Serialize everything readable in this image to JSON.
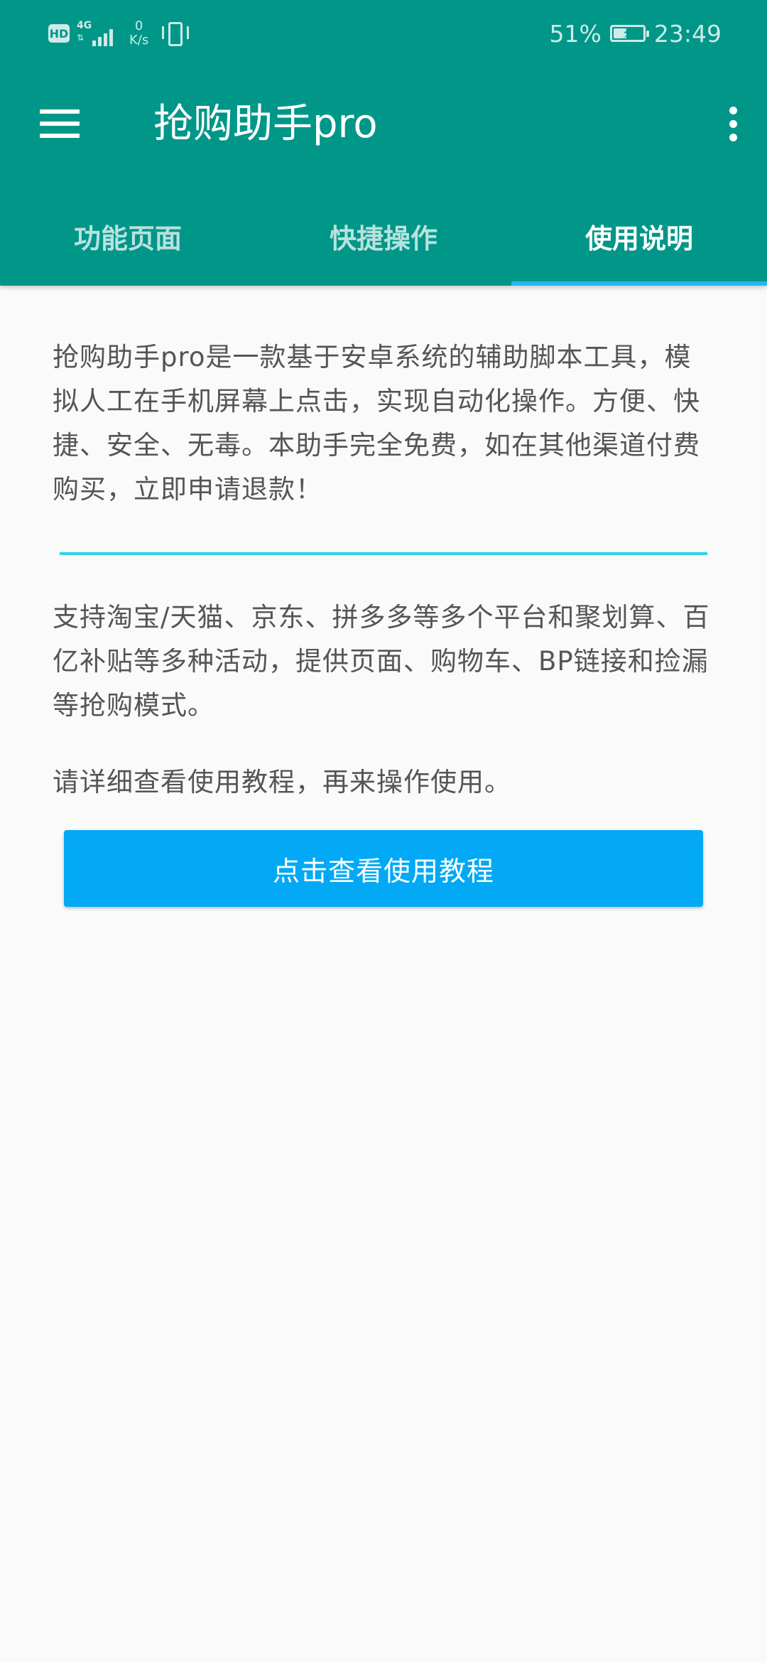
{
  "status_bar": {
    "hd_label": "HD",
    "network_type": "4G",
    "speed_value": "0",
    "speed_unit": "K/s",
    "battery_percent": "51%",
    "battery_level": 0.51,
    "time": "23:49"
  },
  "toolbar": {
    "title": "抢购助手pro",
    "menu_icon": "hamburger-menu-icon",
    "more_icon": "more-vert-icon",
    "background_color": "#009688"
  },
  "tabs": [
    {
      "label": "功能页面",
      "active": false
    },
    {
      "label": "快捷操作",
      "active": false
    },
    {
      "label": "使用说明",
      "active": true
    }
  ],
  "content": {
    "intro": "抢购助手pro是一款基于安卓系统的辅助脚本工具，模拟人工在手机屏幕上点击，实现自动化操作。方便、快捷、安全、无毒。本助手完全免费，如在其他渠道付费购买，立即申请退款！",
    "platforms": "支持淘宝/天猫、京东、拼多多等多个平台和聚划算、百亿补贴等多种活动，提供页面、购物车、BP链接和捡漏等抢购模式。",
    "notice": "请详细查看使用教程，再来操作使用。",
    "tutorial_button": "点击查看使用教程"
  },
  "colors": {
    "accent": "#03A9F4",
    "divider": "#2AD6E6",
    "tab_indicator": "#29B6F6"
  }
}
